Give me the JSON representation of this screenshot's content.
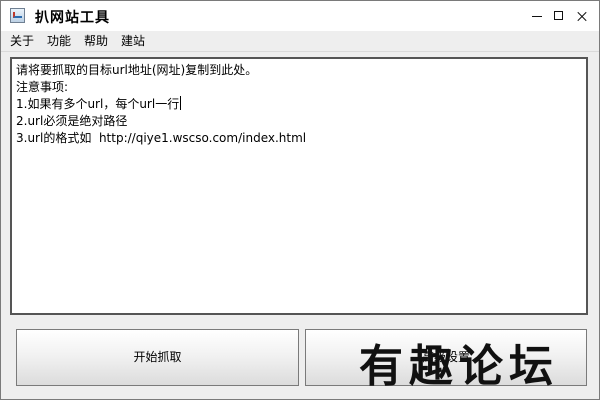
{
  "window": {
    "title": "扒网站工具"
  },
  "menubar": {
    "items": [
      {
        "label": "关于"
      },
      {
        "label": "功能"
      },
      {
        "label": "帮助"
      },
      {
        "label": "建站"
      }
    ]
  },
  "main": {
    "textarea_lines": [
      "请将要抓取的目标url地址(网址)复制到此处。",
      "注意事项:",
      "1.如果有多个url，每个url一行",
      "2.url必须是绝对路径",
      "3.url的格式如  http://qiye1.wscso.com/index.html"
    ]
  },
  "actions": {
    "start_label": "开始抓取",
    "settings_label": "高级设置"
  },
  "watermark": {
    "text": "有趣论坛"
  },
  "icons": {
    "app": "java-app-icon",
    "minimize": "minimize-icon",
    "maximize": "maximize-icon",
    "close": "close-icon"
  }
}
